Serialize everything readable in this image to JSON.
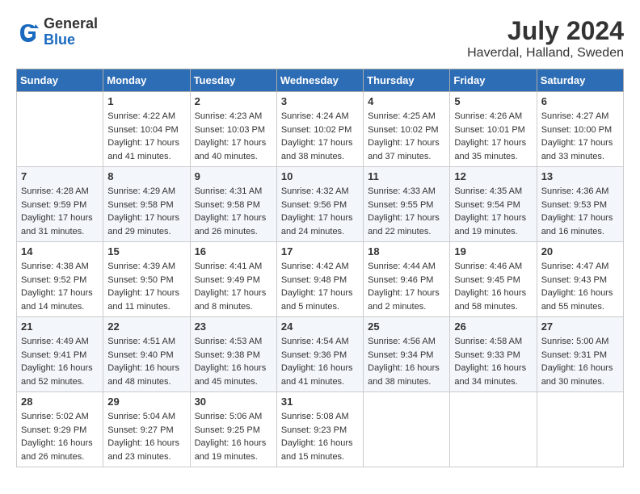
{
  "header": {
    "logo_general": "General",
    "logo_blue": "Blue",
    "month_year": "July 2024",
    "location": "Haverdal, Halland, Sweden"
  },
  "days_of_week": [
    "Sunday",
    "Monday",
    "Tuesday",
    "Wednesday",
    "Thursday",
    "Friday",
    "Saturday"
  ],
  "weeks": [
    [
      {
        "day": "",
        "sunrise": "",
        "sunset": "",
        "daylight": ""
      },
      {
        "day": "1",
        "sunrise": "Sunrise: 4:22 AM",
        "sunset": "Sunset: 10:04 PM",
        "daylight": "Daylight: 17 hours and 41 minutes."
      },
      {
        "day": "2",
        "sunrise": "Sunrise: 4:23 AM",
        "sunset": "Sunset: 10:03 PM",
        "daylight": "Daylight: 17 hours and 40 minutes."
      },
      {
        "day": "3",
        "sunrise": "Sunrise: 4:24 AM",
        "sunset": "Sunset: 10:02 PM",
        "daylight": "Daylight: 17 hours and 38 minutes."
      },
      {
        "day": "4",
        "sunrise": "Sunrise: 4:25 AM",
        "sunset": "Sunset: 10:02 PM",
        "daylight": "Daylight: 17 hours and 37 minutes."
      },
      {
        "day": "5",
        "sunrise": "Sunrise: 4:26 AM",
        "sunset": "Sunset: 10:01 PM",
        "daylight": "Daylight: 17 hours and 35 minutes."
      },
      {
        "day": "6",
        "sunrise": "Sunrise: 4:27 AM",
        "sunset": "Sunset: 10:00 PM",
        "daylight": "Daylight: 17 hours and 33 minutes."
      }
    ],
    [
      {
        "day": "7",
        "sunrise": "Sunrise: 4:28 AM",
        "sunset": "Sunset: 9:59 PM",
        "daylight": "Daylight: 17 hours and 31 minutes."
      },
      {
        "day": "8",
        "sunrise": "Sunrise: 4:29 AM",
        "sunset": "Sunset: 9:58 PM",
        "daylight": "Daylight: 17 hours and 29 minutes."
      },
      {
        "day": "9",
        "sunrise": "Sunrise: 4:31 AM",
        "sunset": "Sunset: 9:58 PM",
        "daylight": "Daylight: 17 hours and 26 minutes."
      },
      {
        "day": "10",
        "sunrise": "Sunrise: 4:32 AM",
        "sunset": "Sunset: 9:56 PM",
        "daylight": "Daylight: 17 hours and 24 minutes."
      },
      {
        "day": "11",
        "sunrise": "Sunrise: 4:33 AM",
        "sunset": "Sunset: 9:55 PM",
        "daylight": "Daylight: 17 hours and 22 minutes."
      },
      {
        "day": "12",
        "sunrise": "Sunrise: 4:35 AM",
        "sunset": "Sunset: 9:54 PM",
        "daylight": "Daylight: 17 hours and 19 minutes."
      },
      {
        "day": "13",
        "sunrise": "Sunrise: 4:36 AM",
        "sunset": "Sunset: 9:53 PM",
        "daylight": "Daylight: 17 hours and 16 minutes."
      }
    ],
    [
      {
        "day": "14",
        "sunrise": "Sunrise: 4:38 AM",
        "sunset": "Sunset: 9:52 PM",
        "daylight": "Daylight: 17 hours and 14 minutes."
      },
      {
        "day": "15",
        "sunrise": "Sunrise: 4:39 AM",
        "sunset": "Sunset: 9:50 PM",
        "daylight": "Daylight: 17 hours and 11 minutes."
      },
      {
        "day": "16",
        "sunrise": "Sunrise: 4:41 AM",
        "sunset": "Sunset: 9:49 PM",
        "daylight": "Daylight: 17 hours and 8 minutes."
      },
      {
        "day": "17",
        "sunrise": "Sunrise: 4:42 AM",
        "sunset": "Sunset: 9:48 PM",
        "daylight": "Daylight: 17 hours and 5 minutes."
      },
      {
        "day": "18",
        "sunrise": "Sunrise: 4:44 AM",
        "sunset": "Sunset: 9:46 PM",
        "daylight": "Daylight: 17 hours and 2 minutes."
      },
      {
        "day": "19",
        "sunrise": "Sunrise: 4:46 AM",
        "sunset": "Sunset: 9:45 PM",
        "daylight": "Daylight: 16 hours and 58 minutes."
      },
      {
        "day": "20",
        "sunrise": "Sunrise: 4:47 AM",
        "sunset": "Sunset: 9:43 PM",
        "daylight": "Daylight: 16 hours and 55 minutes."
      }
    ],
    [
      {
        "day": "21",
        "sunrise": "Sunrise: 4:49 AM",
        "sunset": "Sunset: 9:41 PM",
        "daylight": "Daylight: 16 hours and 52 minutes."
      },
      {
        "day": "22",
        "sunrise": "Sunrise: 4:51 AM",
        "sunset": "Sunset: 9:40 PM",
        "daylight": "Daylight: 16 hours and 48 minutes."
      },
      {
        "day": "23",
        "sunrise": "Sunrise: 4:53 AM",
        "sunset": "Sunset: 9:38 PM",
        "daylight": "Daylight: 16 hours and 45 minutes."
      },
      {
        "day": "24",
        "sunrise": "Sunrise: 4:54 AM",
        "sunset": "Sunset: 9:36 PM",
        "daylight": "Daylight: 16 hours and 41 minutes."
      },
      {
        "day": "25",
        "sunrise": "Sunrise: 4:56 AM",
        "sunset": "Sunset: 9:34 PM",
        "daylight": "Daylight: 16 hours and 38 minutes."
      },
      {
        "day": "26",
        "sunrise": "Sunrise: 4:58 AM",
        "sunset": "Sunset: 9:33 PM",
        "daylight": "Daylight: 16 hours and 34 minutes."
      },
      {
        "day": "27",
        "sunrise": "Sunrise: 5:00 AM",
        "sunset": "Sunset: 9:31 PM",
        "daylight": "Daylight: 16 hours and 30 minutes."
      }
    ],
    [
      {
        "day": "28",
        "sunrise": "Sunrise: 5:02 AM",
        "sunset": "Sunset: 9:29 PM",
        "daylight": "Daylight: 16 hours and 26 minutes."
      },
      {
        "day": "29",
        "sunrise": "Sunrise: 5:04 AM",
        "sunset": "Sunset: 9:27 PM",
        "daylight": "Daylight: 16 hours and 23 minutes."
      },
      {
        "day": "30",
        "sunrise": "Sunrise: 5:06 AM",
        "sunset": "Sunset: 9:25 PM",
        "daylight": "Daylight: 16 hours and 19 minutes."
      },
      {
        "day": "31",
        "sunrise": "Sunrise: 5:08 AM",
        "sunset": "Sunset: 9:23 PM",
        "daylight": "Daylight: 16 hours and 15 minutes."
      },
      {
        "day": "",
        "sunrise": "",
        "sunset": "",
        "daylight": ""
      },
      {
        "day": "",
        "sunrise": "",
        "sunset": "",
        "daylight": ""
      },
      {
        "day": "",
        "sunrise": "",
        "sunset": "",
        "daylight": ""
      }
    ]
  ]
}
